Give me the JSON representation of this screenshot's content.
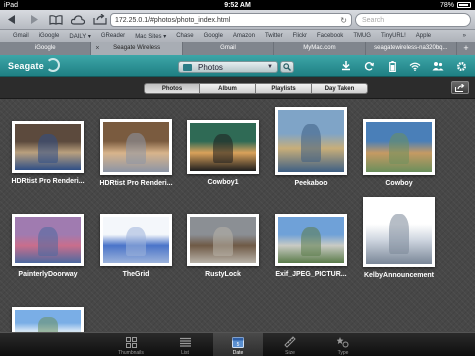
{
  "status": {
    "carrier": "iPad",
    "time": "9:52 AM",
    "battery": "78%"
  },
  "browser": {
    "url": "172.25.0.1/#photos/photo_index.html",
    "search_placeholder": "Search",
    "bookmarks": [
      "Gmail",
      "iGoogle",
      "DAILY ▾",
      "GReader",
      "Mac Sites ▾",
      "Chase",
      "Google",
      "Amazon",
      "Twitter",
      "Flickr",
      "Facebook",
      "TMUG",
      "TinyURL!",
      "Apple"
    ],
    "bookmarks_more": "»",
    "tabs": [
      {
        "label": "iGoogle",
        "active": false
      },
      {
        "label": "Seagate Wireless",
        "active": true
      },
      {
        "label": "Gmail",
        "active": false
      },
      {
        "label": "MyMac.com",
        "active": false
      },
      {
        "label": "seagatewireless-na320bq...",
        "active": false
      }
    ],
    "tab_add": "+"
  },
  "app": {
    "logo": "Seagate",
    "section": "Photos",
    "header_icons": [
      "download-icon",
      "sync-icon",
      "battery-icon",
      "wifi-icon",
      "users-icon",
      "gear-icon"
    ]
  },
  "sort": {
    "options": [
      "Photos",
      "Album",
      "Playlists",
      "Day Taken"
    ],
    "active": "Photos"
  },
  "photos": [
    {
      "name": "HDRtist Pro Renderi...",
      "colors": [
        "#5c4a3d",
        "#b9a07e",
        "#2f4f86"
      ]
    },
    {
      "name": "HDRtist Pro Renderi...",
      "colors": [
        "#7a5b3f",
        "#d8b48b",
        "#8c95a6"
      ]
    },
    {
      "name": "Cowboy1",
      "colors": [
        "#2f6a55",
        "#d9a15a",
        "#1e1e1e"
      ]
    },
    {
      "name": "Peekaboo",
      "colors": [
        "#7fa4c7",
        "#c8ae79",
        "#3e5f84"
      ]
    },
    {
      "name": "Cowboy",
      "colors": [
        "#4a7fb8",
        "#c59a63",
        "#6b8f5c"
      ]
    },
    {
      "name": "PainterlyDoorway",
      "colors": [
        "#a07bb0",
        "#c96e8c",
        "#4d6aa0"
      ]
    },
    {
      "name": "TheGrid",
      "colors": [
        "#f4f7fb",
        "#4a74c9",
        "#9cb3db"
      ]
    },
    {
      "name": "RustyLock",
      "colors": [
        "#8b8f94",
        "#6f5a46",
        "#b8b2a8"
      ]
    },
    {
      "name": "Exif_JPEG_PICTUR...",
      "colors": [
        "#6fa1d8",
        "#c9cbc4",
        "#5b7c4a"
      ]
    },
    {
      "name": "KelbyAnnouncement",
      "colors": [
        "#ffffff",
        "#cfd6e0",
        "#7a8798"
      ]
    },
    {
      "name": "",
      "colors": [
        "#7aaee6",
        "#d6e6f5",
        "#6a8f5e"
      ]
    }
  ],
  "bottom_tabs": [
    {
      "label": "Thumbnails",
      "icon": "grid-icon",
      "active": false
    },
    {
      "label": "List",
      "icon": "list-icon",
      "active": false
    },
    {
      "label": "Date",
      "icon": "calendar-icon",
      "active": true
    },
    {
      "label": "Size",
      "icon": "ruler-icon",
      "active": false
    },
    {
      "label": "Type",
      "icon": "shapes-icon",
      "active": false
    }
  ]
}
